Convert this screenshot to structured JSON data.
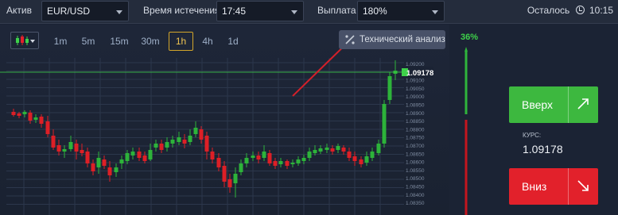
{
  "topbar": {
    "asset_label": "Актив",
    "asset_value": "EUR/USD",
    "expiry_label": "Время истечения",
    "expiry_value": "17:45",
    "payout_label": "Выплата",
    "payout_value": "180%",
    "remaining_label": "Осталось",
    "remaining_time": "10:15"
  },
  "chart_toolbar": {
    "timeframes": [
      "1m",
      "5m",
      "15m",
      "30m",
      "1h",
      "4h",
      "1d"
    ],
    "active_timeframe": "1h",
    "tech_analysis_label": "Технический анализ"
  },
  "chart": {
    "current_price": "1.09178",
    "price_axis_labels": [
      "1.09200",
      "1.09150",
      "1.09100",
      "1.09050",
      "1.09000",
      "1.08950",
      "1.08900",
      "1.08850",
      "1.08800",
      "1.08750",
      "1.08700",
      "1.08650",
      "1.08600",
      "1.08550",
      "1.08500",
      "1.08450",
      "1.08400",
      "1.08350"
    ],
    "colors": {
      "up": "#2db33a",
      "down": "#dd1f26",
      "price_line": "#3ed14a",
      "annotation_arrow": "#d2202a"
    }
  },
  "trade_panel": {
    "sentiment_percent": "36%",
    "up_label": "Вверх",
    "down_label": "Вниз",
    "rate_label": "КУРС:",
    "rate_value": "1.09178",
    "colors": {
      "up": "#3db83f",
      "down": "#e2212b"
    }
  },
  "icons": [
    "chevron-down-icon",
    "clock-icon",
    "candlestick-icon",
    "technical-analysis-icon",
    "arrow-up-right-icon",
    "arrow-down-right-icon"
  ]
}
